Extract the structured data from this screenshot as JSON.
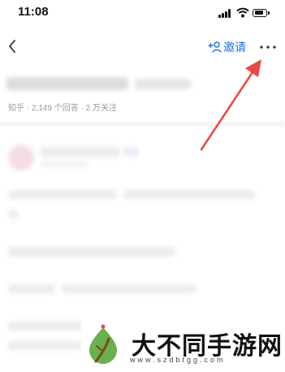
{
  "status_bar": {
    "time": "11:08"
  },
  "nav_bar": {
    "invite_label": "邀请",
    "accent_color": "#1e6fe0"
  },
  "question": {
    "meta": "知乎 · 2,149 个回答 · 2 万关注"
  },
  "annotation": {
    "arrow_color": "#e84a48"
  },
  "watermark": {
    "title": "大不同手游网",
    "url": "www.szdbtgg.com"
  },
  "icons": [
    "back-icon",
    "invite-icon",
    "more-icon",
    "signal-icon",
    "wifi-icon",
    "battery-icon"
  ]
}
